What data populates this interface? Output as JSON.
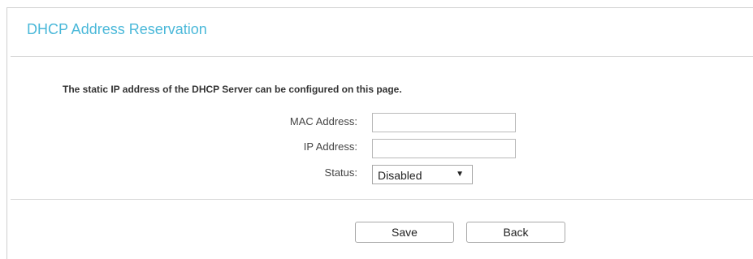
{
  "page": {
    "title": "DHCP Address Reservation",
    "description": "The static IP address of the DHCP Server can be configured on this page."
  },
  "form": {
    "mac_label": "MAC Address:",
    "mac_value": "",
    "ip_label": "IP Address:",
    "ip_value": "",
    "status_label": "Status:",
    "status_value": "Disabled",
    "status_arrow_icon": "triangle-down"
  },
  "buttons": {
    "save_label": "Save",
    "back_label": "Back"
  },
  "colors": {
    "title": "#4ab8d9",
    "divider": "#d6d6d6",
    "border": "#b9b9b9"
  }
}
